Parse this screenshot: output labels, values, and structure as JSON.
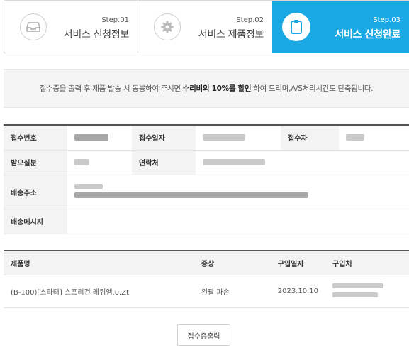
{
  "steps": [
    {
      "num": "Step.01",
      "label": "서비스 신청정보",
      "icon": "tray-icon"
    },
    {
      "num": "Step.02",
      "label": "서비스 제품정보",
      "icon": "gear-icon"
    },
    {
      "num": "Step.03",
      "label": "서비스 신청완료",
      "icon": "clipboard-icon"
    }
  ],
  "notice": {
    "before": "접수증을 출력 후 제품 발송 시 동봉하여 주시면",
    "bold": "수리비의 10%를 할인",
    "after": "하여 드리며,A/S처리시간도 단축됩니다."
  },
  "info": {
    "receipt_no_label": "접수번호",
    "receipt_date_label": "접수일자",
    "receiver_label": "접수자",
    "recipient_label": "받으실분",
    "contact_label": "연락처",
    "address_label": "배송주소",
    "message_label": "배송메시지"
  },
  "product": {
    "headers": [
      "제품명",
      "증상",
      "구입일자",
      "구입처"
    ],
    "row": {
      "name": "(B-100)[스타터] 스프리건 레퀴엠.0.Zt",
      "symptom": "왼팔 파손",
      "date": "2023.10.10"
    }
  },
  "print_button": "접수증출력",
  "colors": {
    "accent": "#1ba9e6"
  }
}
